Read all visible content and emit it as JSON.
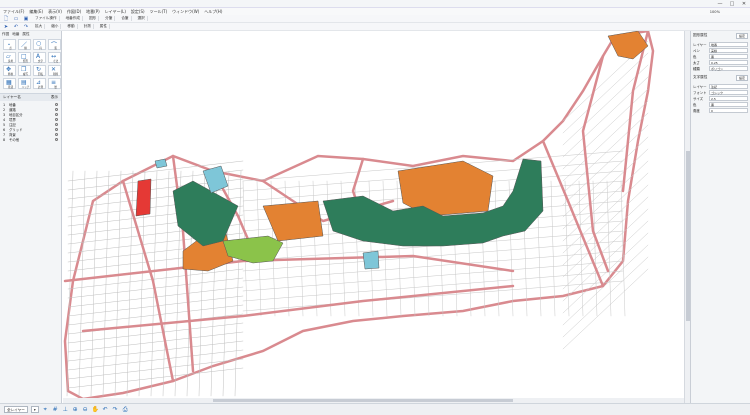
{
  "window": {
    "title": "",
    "controls": [
      "—",
      "□",
      "✕"
    ]
  },
  "menu": [
    "ファイル(F)",
    "編集(E)",
    "表示(V)",
    "作図(D)",
    "地番(P)",
    "レイヤー(L)",
    "設定(S)",
    "ツール(T)",
    "ウィンドウ(W)",
    "ヘルプ(H)"
  ],
  "toolbar1": [
    "ファイル操作",
    "地番作成",
    "図形",
    "分筆",
    "合筆",
    "選択"
  ],
  "toolbar2": [
    "拡大",
    "縮小",
    "移動",
    "計測",
    "属性"
  ],
  "zoom": "100%",
  "left_panel": {
    "tabs": [
      "作図",
      "地番",
      "属性"
    ],
    "tools": [
      {
        "icon": "point-icon",
        "glyph": "・",
        "label": "点"
      },
      {
        "icon": "line-icon",
        "glyph": "／",
        "label": "線"
      },
      {
        "icon": "circle-icon",
        "glyph": "○",
        "label": "円"
      },
      {
        "icon": "arc-icon",
        "glyph": "⌒",
        "label": "弧"
      },
      {
        "icon": "polygon-icon",
        "glyph": "▱",
        "label": "多角"
      },
      {
        "icon": "rect-icon",
        "glyph": "□",
        "label": "矩形"
      },
      {
        "icon": "text-icon",
        "glyph": "A",
        "label": "文字"
      },
      {
        "icon": "dimension-icon",
        "glyph": "↔",
        "label": "寸法"
      },
      {
        "icon": "move-icon",
        "glyph": "✥",
        "label": "移動"
      },
      {
        "icon": "copy-icon",
        "glyph": "❐",
        "label": "複写"
      },
      {
        "icon": "rotate-icon",
        "glyph": "↻",
        "label": "回転"
      },
      {
        "icon": "delete-icon",
        "glyph": "✕",
        "label": "削除"
      },
      {
        "icon": "fill-icon",
        "glyph": "▦",
        "label": "塗潰"
      },
      {
        "icon": "hatch-icon",
        "glyph": "▤",
        "label": "ハッチ"
      },
      {
        "icon": "measure-icon",
        "glyph": "⊿",
        "label": "計測"
      },
      {
        "icon": "layer-icon",
        "glyph": "≡",
        "label": "層"
      }
    ],
    "layer_header": {
      "name": "レイヤー名",
      "show": "表示"
    },
    "layers": [
      {
        "no": "1",
        "name": "地番"
      },
      {
        "no": "2",
        "name": "道路"
      },
      {
        "no": "3",
        "name": "地目区分"
      },
      {
        "no": "4",
        "name": "境界"
      },
      {
        "no": "5",
        "name": "注記"
      },
      {
        "no": "6",
        "name": "グリッド"
      },
      {
        "no": "7",
        "name": "背景"
      },
      {
        "no": "8",
        "name": "その他"
      }
    ]
  },
  "right_panel": {
    "sections": [
      {
        "title": "図形属性",
        "button": "設定",
        "props": [
          {
            "k": "レイヤー",
            "v": "地番"
          },
          {
            "k": "ペン",
            "v": "実線"
          },
          {
            "k": "色",
            "v": "黒"
          },
          {
            "k": "太さ",
            "v": "0.25"
          },
          {
            "k": "種類",
            "v": "ポリゴン"
          }
        ]
      },
      {
        "title": "文字属性",
        "button": "設定",
        "props": [
          {
            "k": "レイヤー",
            "v": "注記"
          },
          {
            "k": "フォント",
            "v": "ゴシック"
          },
          {
            "k": "サイズ",
            "v": "2.5"
          },
          {
            "k": "色",
            "v": "黒"
          },
          {
            "k": "角度",
            "v": "0"
          }
        ]
      }
    ]
  },
  "bottom": {
    "select_value": "全レイヤー",
    "icons": [
      "snap-icon",
      "grid-icon",
      "ortho-icon",
      "zoom-in-icon",
      "zoom-out-icon",
      "pan-icon",
      "undo-icon",
      "redo-icon",
      "print-icon"
    ]
  },
  "colors": {
    "road": "#d98a8f",
    "orange": "#e38232",
    "green": "#2e7d5b",
    "lightgreen": "#8bc34a",
    "blue": "#7ec6d8",
    "red": "#e53935"
  }
}
